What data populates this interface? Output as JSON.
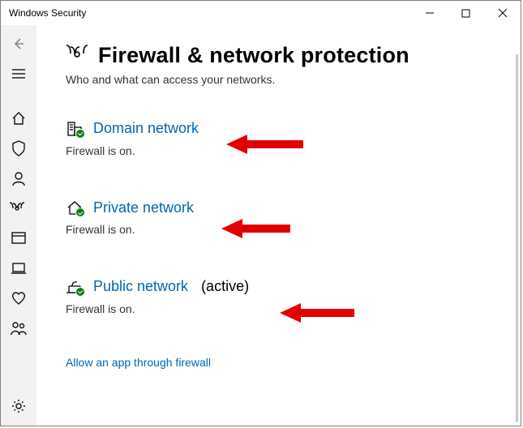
{
  "window": {
    "title": "Windows Security"
  },
  "page": {
    "title": "Firewall & network protection",
    "subtitle": "Who and what can access your networks."
  },
  "networks": [
    {
      "label": "Domain network",
      "suffix": "",
      "status": "Firewall is on."
    },
    {
      "label": "Private network",
      "suffix": "",
      "status": "Firewall is on."
    },
    {
      "label": "Public network",
      "suffix": "(active)",
      "status": "Firewall is on."
    }
  ],
  "footer": {
    "allow_app_link": "Allow an app through firewall"
  }
}
